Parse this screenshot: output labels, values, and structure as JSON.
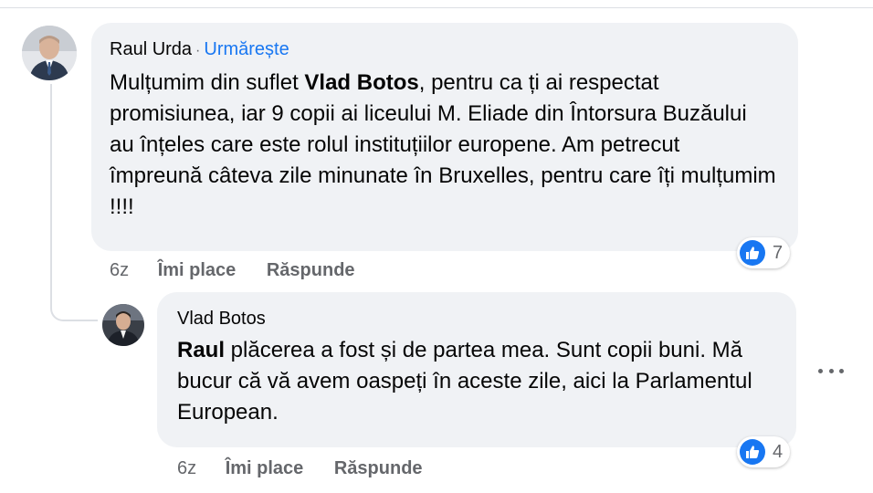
{
  "comments": [
    {
      "author": "Raul Urda",
      "follow_label": "Urmărește",
      "separator": "·",
      "text_parts": [
        "Mulțumim din suflet ",
        "Vlad Botos",
        ", pentru ca ți ai respectat promisiunea, iar 9 copii ai liceului M. Eliade din Întorsura Buzăului au înțeles care este rolul instituțiilor europene. Am petrecut împreună câteva zile minunate în Bruxelles, pentru care îți mulțumim !!!!"
      ],
      "time": "6z",
      "like_label": "Îmi place",
      "reply_label": "Răspunde",
      "reaction_icon": "like-icon",
      "reaction_count": "7"
    },
    {
      "author": "Vlad Botos",
      "text_parts": [
        "Raul",
        " plăcerea a fost și de partea mea. Sunt copii buni. Mă bucur că vă avem oaspeți în aceste zile, aici la Parlamentul European."
      ],
      "time": "6z",
      "like_label": "Îmi place",
      "reply_label": "Răspunde",
      "reaction_icon": "like-icon",
      "reaction_count": "4",
      "more_icon": "more-horizontal-icon"
    }
  ],
  "colors": {
    "bubble": "#f0f2f5",
    "link": "#1877f2",
    "secondary_text": "#65676b",
    "like_badge": "#1877f2"
  }
}
